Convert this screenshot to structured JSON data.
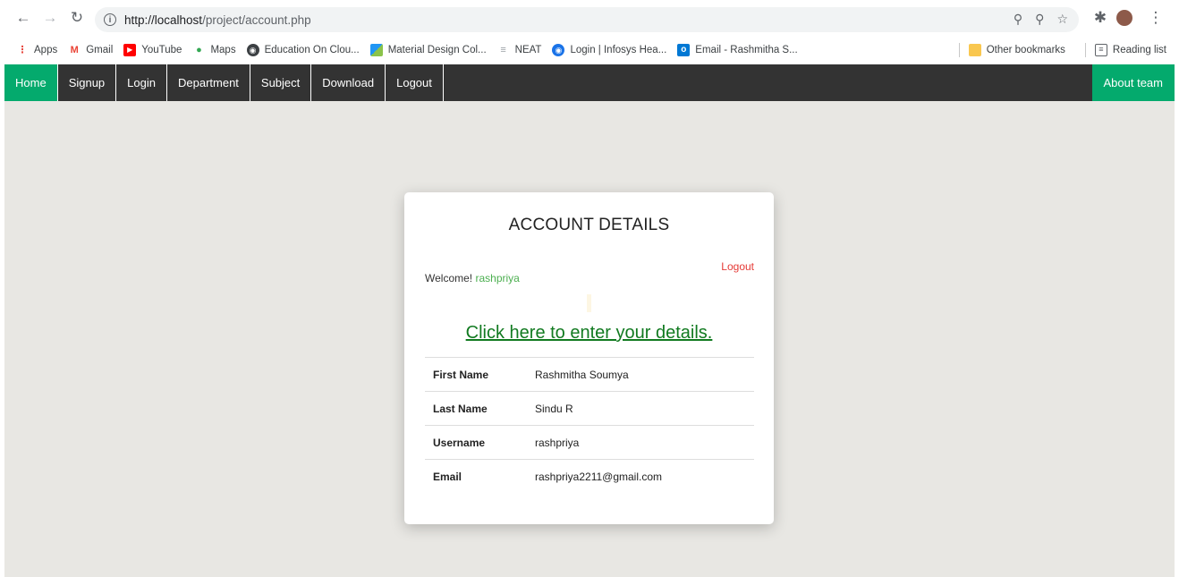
{
  "browser": {
    "url_host": "http://localhost",
    "url_path": "/project/account.php",
    "bookmarks": [
      {
        "label": "Apps",
        "icon": "apps-grid-icon",
        "color": "#e8453c"
      },
      {
        "label": "Gmail",
        "icon": "gmail-icon",
        "color": "#ea4335"
      },
      {
        "label": "YouTube",
        "icon": "youtube-icon",
        "color": "#ff0000"
      },
      {
        "label": "Maps",
        "icon": "maps-pin-icon",
        "color": "#34a853"
      },
      {
        "label": "Education On Clou...",
        "icon": "globe-icon",
        "color": "#3c4043"
      },
      {
        "label": "Material Design Col...",
        "icon": "material-design-icon",
        "color": "#2196f3"
      },
      {
        "label": "NEAT",
        "icon": "neat-icon",
        "color": "#9aa0a6"
      },
      {
        "label": "Login | Infosys Hea...",
        "icon": "infosys-icon",
        "color": "#1a73e8"
      },
      {
        "label": "Email - Rashmitha S...",
        "icon": "outlook-icon",
        "color": "#0078d4"
      }
    ],
    "other_bookmarks": "Other bookmarks",
    "reading_list": "Reading list"
  },
  "nav": {
    "items": [
      "Home",
      "Signup",
      "Login",
      "Department",
      "Subject",
      "Download",
      "Logout"
    ],
    "about": "About team",
    "active_color": "#04aa6d"
  },
  "card": {
    "title": "ACCOUNT DETAILS",
    "welcome_prefix": "Welcome! ",
    "username": "rashpriya",
    "logout": "Logout",
    "details_link": "Click here to enter your details.",
    "rows": [
      {
        "label": "First Name",
        "value": "Rashmitha Soumya"
      },
      {
        "label": "Last Name",
        "value": "Sindu R"
      },
      {
        "label": "Username",
        "value": "rashpriya"
      },
      {
        "label": "Email",
        "value": "rashpriya2211@gmail.com"
      }
    ]
  }
}
